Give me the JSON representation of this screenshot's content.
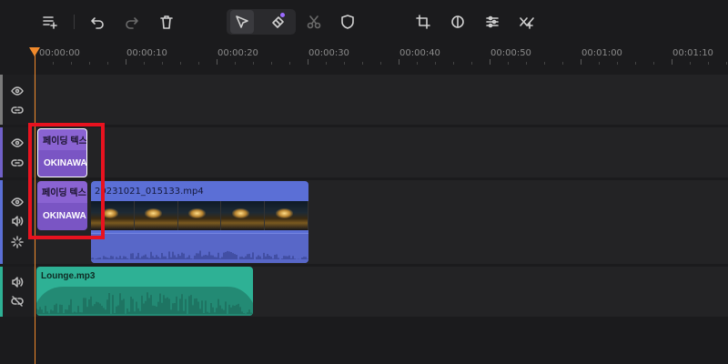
{
  "toolbar": {
    "icons": [
      "add-track-icon",
      "undo-icon",
      "redo-icon",
      "delete-icon",
      "select-icon",
      "tag-icon",
      "cut-icon",
      "mask-icon",
      "crop-icon",
      "color-icon",
      "adjust-icon",
      "transition-icon"
    ]
  },
  "ruler": {
    "labels": [
      "00:00:00",
      "00:00:10",
      "00:00:20",
      "00:00:30",
      "00:00:40",
      "00:00:50",
      "00:01:00",
      "00:01:10"
    ]
  },
  "tracks": {
    "title1": {
      "top_label": "페이딩 텍스",
      "bottom_label": "OKINAWA"
    },
    "title2": {
      "top_label": "페이딩 텍스",
      "bottom_label": "OKINAWA"
    },
    "video": {
      "name": "20231021_015133.mp4"
    },
    "audio": {
      "name": "Lounge.mp3"
    }
  },
  "colors": {
    "accent": "#9b6bff",
    "playhead": "#f08a2c",
    "title_clip": "#8a63d2",
    "video_clip": "#5b6fd6",
    "audio_clip": "#2eb195",
    "highlight": "#e8121f"
  }
}
